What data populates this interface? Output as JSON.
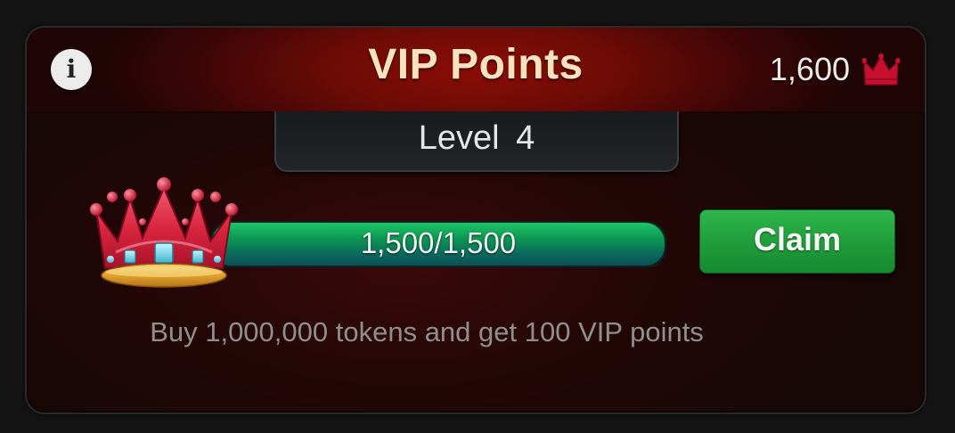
{
  "header": {
    "title": "VIP Points",
    "info_icon": "info-icon",
    "info_symbol": "i",
    "points_value": "1,600",
    "points_icon": "crown-icon"
  },
  "level": {
    "label": "Level  4"
  },
  "progress": {
    "text": "1,500/1,500",
    "fraction": 1.0
  },
  "claim": {
    "label": "Claim"
  },
  "offer": {
    "text": "Buy 1,000,000 tokens and get 100 VIP points"
  },
  "colors": {
    "header_red": "#8c0d05",
    "title_cream": "#f7e2bf",
    "progress_green": "#0c9a52",
    "claim_green": "#1f9c3a",
    "crown_red": "#c8102e"
  }
}
